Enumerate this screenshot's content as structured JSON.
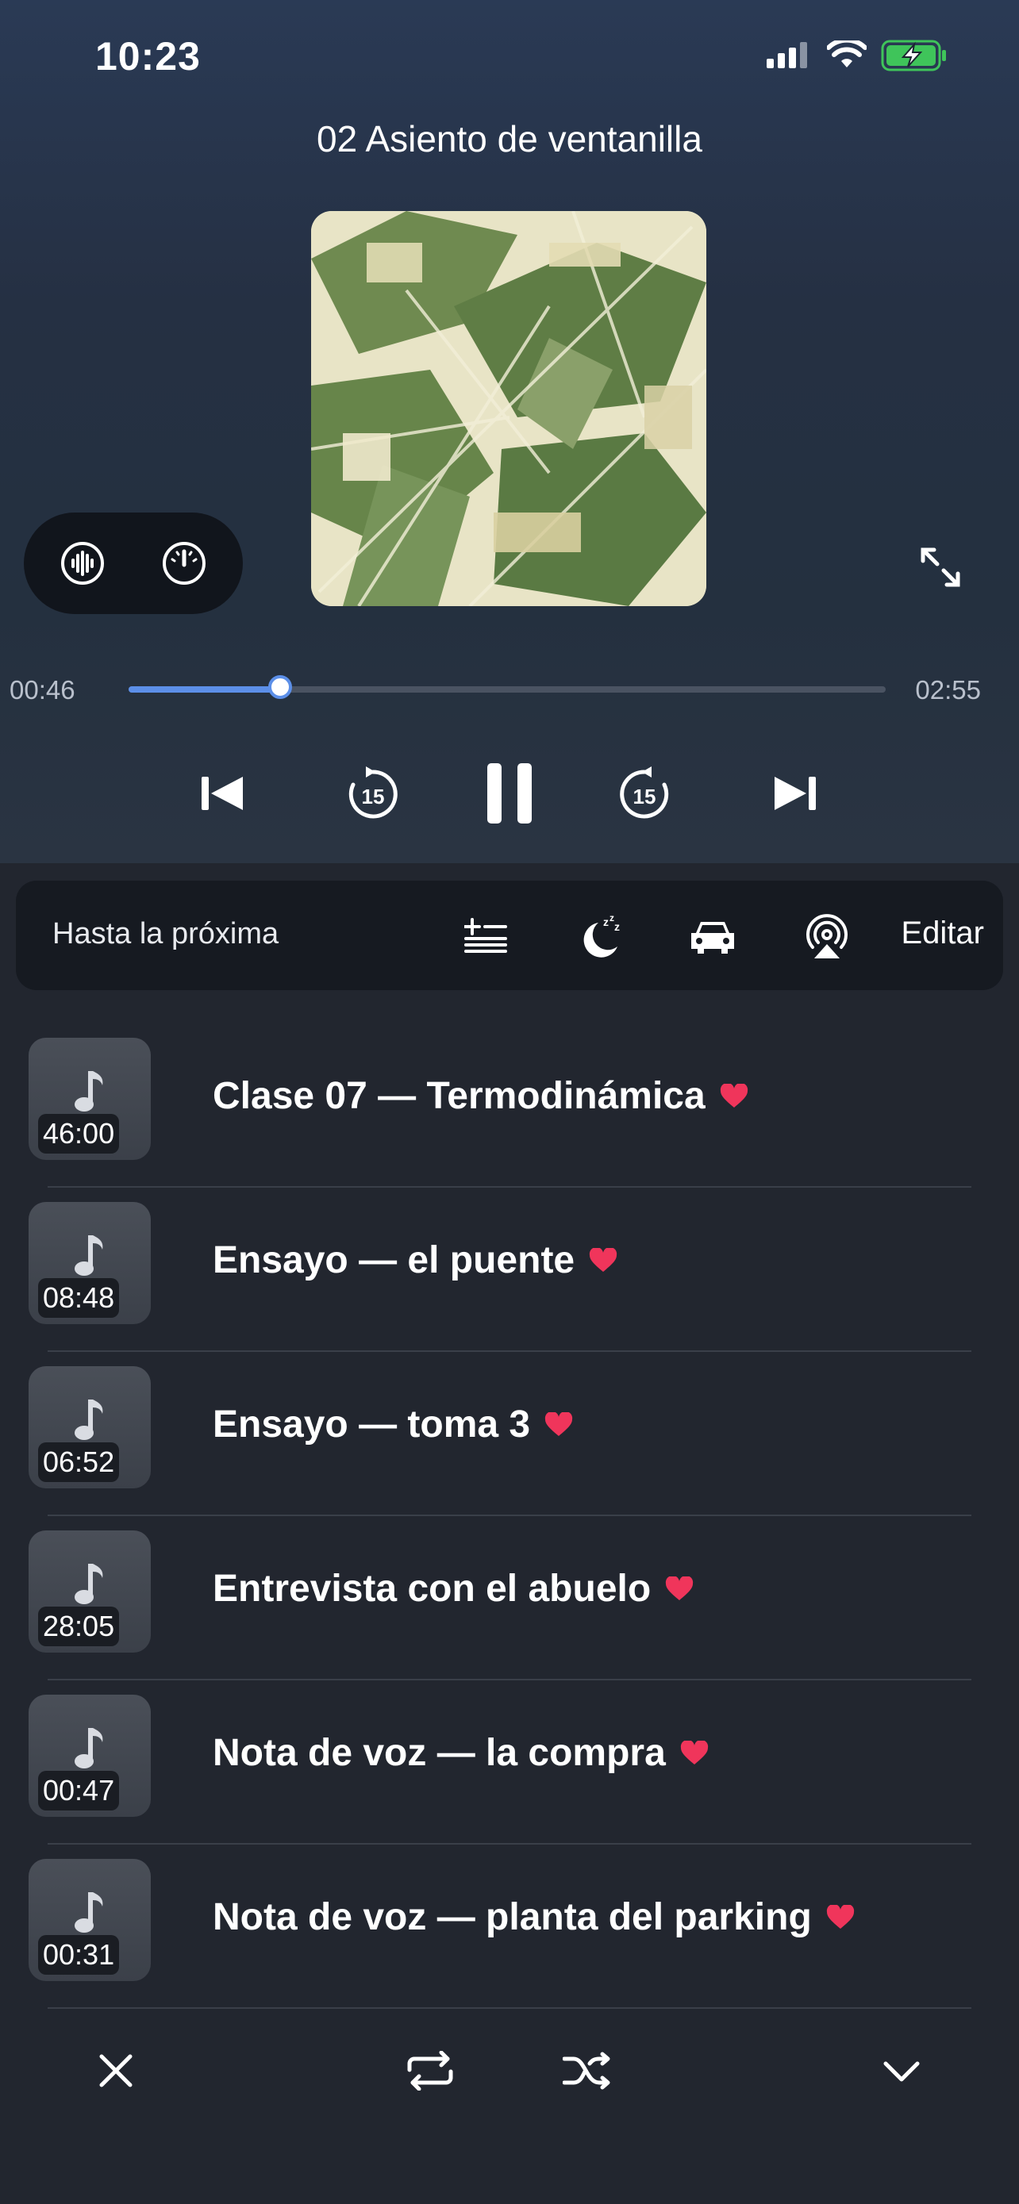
{
  "status": {
    "time": "10:23"
  },
  "player": {
    "title": "02 Asiento de ventanilla",
    "elapsed": "00:46",
    "total": "02:55",
    "progress": 0.2,
    "accent": "#5c8fe8"
  },
  "toolbar": {
    "label": "Hasta la próxima",
    "edit": "Editar",
    "icons": [
      "playlist-add-icon",
      "sleep-timer-icon",
      "car-mode-icon",
      "airplay-icon"
    ]
  },
  "tracks": [
    {
      "title": "Clase 07 — Termodinámica",
      "duration": "46:00",
      "favorite": true
    },
    {
      "title": "Ensayo — el puente",
      "duration": "08:48",
      "favorite": true
    },
    {
      "title": "Ensayo — toma 3",
      "duration": "06:52",
      "favorite": true
    },
    {
      "title": "Entrevista con el abuelo",
      "duration": "28:05",
      "favorite": true
    },
    {
      "title": "Nota de voz — la compra",
      "duration": "00:47",
      "favorite": true
    },
    {
      "title": "Nota de voz — planta del parking",
      "duration": "00:31",
      "favorite": true
    }
  ],
  "colors": {
    "heart": "#f0355b",
    "background": "#22262f"
  }
}
